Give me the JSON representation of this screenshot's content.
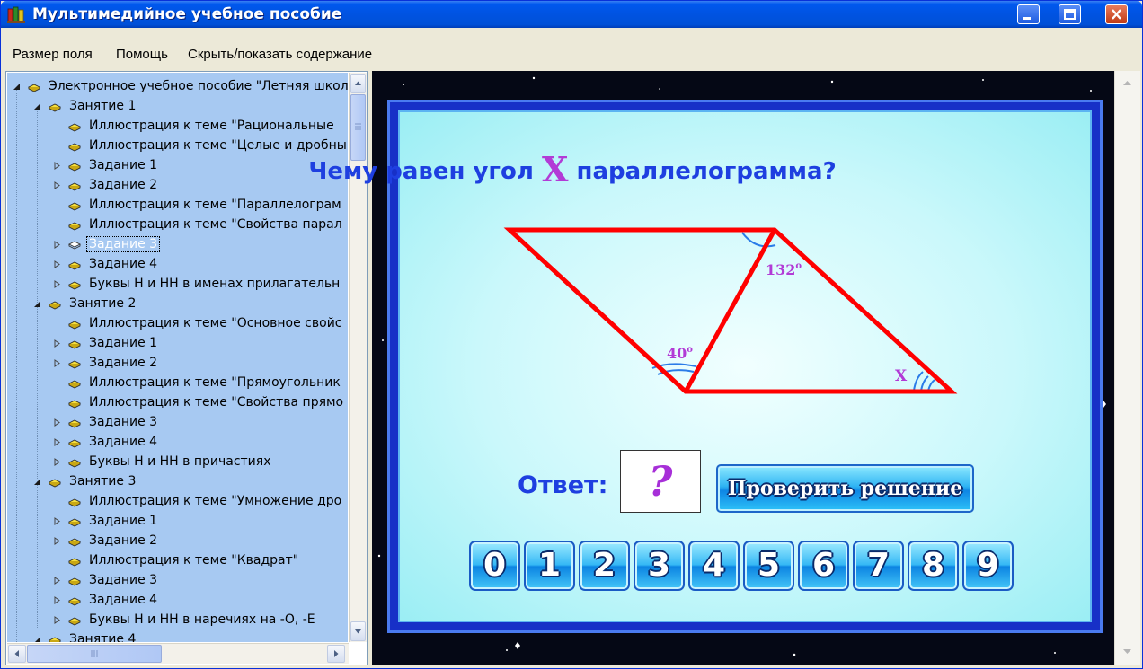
{
  "window": {
    "title": "Мультимедийное учебное пособие"
  },
  "menu": [
    "Размер поля",
    "Помощь",
    "Скрыть/показать содержание"
  ],
  "tree": [
    {
      "label": "Электронное учебное пособие \"Летняя школ",
      "level": 0,
      "expander": "open",
      "icon": "book"
    },
    {
      "label": "Занятие 1",
      "level": 1,
      "expander": "open",
      "icon": "book"
    },
    {
      "label": "Иллюстрация к теме \"Рациональные",
      "level": 2,
      "expander": "",
      "icon": "book"
    },
    {
      "label": "Иллюстрация к теме \"Целые и дробны",
      "level": 2,
      "expander": "",
      "icon": "book"
    },
    {
      "label": "Задание 1",
      "level": 2,
      "expander": "closed",
      "icon": "book"
    },
    {
      "label": "Задание 2",
      "level": 2,
      "expander": "closed",
      "icon": "book"
    },
    {
      "label": "Иллюстрация к теме \"Параллелограм",
      "level": 2,
      "expander": "",
      "icon": "book"
    },
    {
      "label": "Иллюстрация к теме \"Свойства парал",
      "level": 2,
      "expander": "",
      "icon": "book"
    },
    {
      "label": "Задание 3",
      "level": 2,
      "expander": "closed",
      "icon": "open-book",
      "selected": true
    },
    {
      "label": "Задание 4",
      "level": 2,
      "expander": "closed",
      "icon": "book"
    },
    {
      "label": "Буквы Н и НН в именах прилагательн",
      "level": 2,
      "expander": "closed",
      "icon": "book"
    },
    {
      "label": "Занятие 2",
      "level": 1,
      "expander": "open",
      "icon": "book"
    },
    {
      "label": "Иллюстрация к теме \"Основное свойс",
      "level": 2,
      "expander": "",
      "icon": "book"
    },
    {
      "label": "Задание 1",
      "level": 2,
      "expander": "closed",
      "icon": "book"
    },
    {
      "label": "Задание 2",
      "level": 2,
      "expander": "closed",
      "icon": "book"
    },
    {
      "label": "Иллюстрация к теме \"Прямоугольник",
      "level": 2,
      "expander": "",
      "icon": "book"
    },
    {
      "label": "Иллюстрация к теме \"Свойства прямо",
      "level": 2,
      "expander": "",
      "icon": "book"
    },
    {
      "label": "Задание 3",
      "level": 2,
      "expander": "closed",
      "icon": "book"
    },
    {
      "label": "Задание 4",
      "level": 2,
      "expander": "closed",
      "icon": "book"
    },
    {
      "label": "Буквы Н и НН в причастиях",
      "level": 2,
      "expander": "closed",
      "icon": "book"
    },
    {
      "label": "Занятие 3",
      "level": 1,
      "expander": "open",
      "icon": "book"
    },
    {
      "label": "Иллюстрация к теме \"Умножение дро",
      "level": 2,
      "expander": "",
      "icon": "book"
    },
    {
      "label": "Задание 1",
      "level": 2,
      "expander": "closed",
      "icon": "book"
    },
    {
      "label": "Задание 2",
      "level": 2,
      "expander": "closed",
      "icon": "book"
    },
    {
      "label": "Иллюстрация к теме \"Квадрат\"",
      "level": 2,
      "expander": "",
      "icon": "book"
    },
    {
      "label": "Задание 3",
      "level": 2,
      "expander": "closed",
      "icon": "book"
    },
    {
      "label": "Задание 4",
      "level": 2,
      "expander": "closed",
      "icon": "book"
    },
    {
      "label": "Буквы Н и НН в наречиях на -О, -Е",
      "level": 2,
      "expander": "closed",
      "icon": "book"
    },
    {
      "label": "Занятие 4",
      "level": 1,
      "expander": "open",
      "icon": "book"
    }
  ],
  "task": {
    "question_before": "Чему равен угол",
    "question_var": "X",
    "question_after": "параллелограмма?",
    "angle_top": "132",
    "angle_left": "40",
    "angle_degree": "o",
    "angle_x": "X",
    "answer_label": "Ответ:",
    "answer_value": "?",
    "check_label": "Проверить решение",
    "digits": [
      "0",
      "1",
      "2",
      "3",
      "4",
      "5",
      "6",
      "7",
      "8",
      "9"
    ]
  },
  "colors": {
    "shape_stroke": "#FF0000",
    "arc_stroke": "#2A7CE8",
    "accent_text": "#1E3FE0",
    "variable_text": "#B23BD6",
    "tree_background": "#A7C9F2"
  }
}
